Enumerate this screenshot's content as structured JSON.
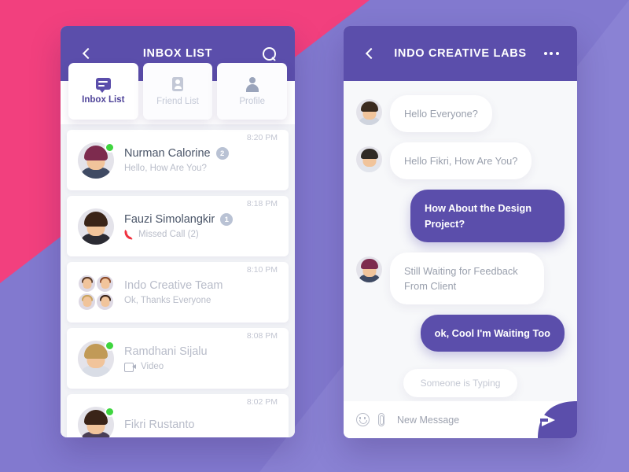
{
  "background": {
    "pink": "#f2407e",
    "purple_light": "#8279cf",
    "purple_mid": "#7b72c9"
  },
  "colors": {
    "brand_purple": "#5b4eab",
    "pink": "#f2407e",
    "online_green": "#3fd53f",
    "badge_gray": "#b9c2d4",
    "missed_call_red": "#f0313f"
  },
  "left_phone": {
    "header": {
      "back_icon": "chevron-left-icon",
      "title": "INBOX LIST",
      "search_icon": "search-icon"
    },
    "tabs": [
      {
        "label": "Inbox List",
        "icon": "chat-bubble-icon",
        "active": true
      },
      {
        "label": "Friend List",
        "icon": "contact-card-icon",
        "active": false
      },
      {
        "label": "Profile",
        "icon": "person-icon",
        "active": false
      }
    ],
    "conversations": [
      {
        "name": "Nurman Calorine",
        "badge": "2",
        "preview": "Hello, How Are You?",
        "time": "8:20 PM",
        "online": true,
        "read": false,
        "sub_icon": "none",
        "avatar_type": "single",
        "hair": "#7d2b4e",
        "shirt": "#3f4a63"
      },
      {
        "name": "Fauzi Simolangkir",
        "badge": "1",
        "preview": "Missed Call (2)",
        "time": "8:18 PM",
        "online": false,
        "read": false,
        "sub_icon": "missed-call-icon",
        "avatar_type": "single",
        "hair": "#3a2418",
        "shirt": "#2b2b33"
      },
      {
        "name": "Indo Creative Team",
        "badge": "",
        "preview": "Ok, Thanks Everyone",
        "time": "8:10 PM",
        "online": false,
        "read": true,
        "sub_icon": "none",
        "avatar_type": "group",
        "hair": "#5a3c2a",
        "shirt": "#56617a"
      },
      {
        "name": "Ramdhani Sijalu",
        "badge": "",
        "preview": "Video",
        "time": "8:08 PM",
        "online": true,
        "read": true,
        "sub_icon": "video-icon",
        "avatar_type": "single",
        "hair": "#c19a57",
        "shirt": "#d9dde6"
      },
      {
        "name": "Fikri Rustanto",
        "badge": "",
        "preview": "",
        "time": "8:02 PM",
        "online": true,
        "read": true,
        "sub_icon": "none",
        "avatar_type": "single",
        "hair": "#3a2418",
        "shirt": "#4a3f56"
      }
    ]
  },
  "right_phone": {
    "header": {
      "back_icon": "chevron-left-icon",
      "title": "INDO CREATIVE LABS",
      "more_icon": "more-options-icon"
    },
    "messages": [
      {
        "text": "Hello Everyone?",
        "side": "in",
        "avatar": true,
        "hair": "#3a2a1e",
        "shirt": "#cfd4de"
      },
      {
        "text": "Hello Fikri, How Are You?",
        "side": "in",
        "avatar": true,
        "hair": "#2f2a26",
        "shirt": "#e2e5ec"
      },
      {
        "text": "How About the Design Project?",
        "side": "out",
        "avatar": false,
        "hair": "",
        "shirt": ""
      },
      {
        "text": "Still Waiting for Feedback From Client",
        "side": "in",
        "avatar": true,
        "hair": "#7d2b4e",
        "shirt": "#3f4a63"
      },
      {
        "text": "ok, Cool I'm Waiting Too",
        "side": "out",
        "avatar": false,
        "hair": "",
        "shirt": ""
      }
    ],
    "typing_indicator": "Someone is Typing",
    "input_bar": {
      "emoji_icon": "smiley-icon",
      "attach_icon": "paperclip-icon",
      "placeholder": "New Message",
      "send_icon": "send-arrow-icon"
    }
  }
}
